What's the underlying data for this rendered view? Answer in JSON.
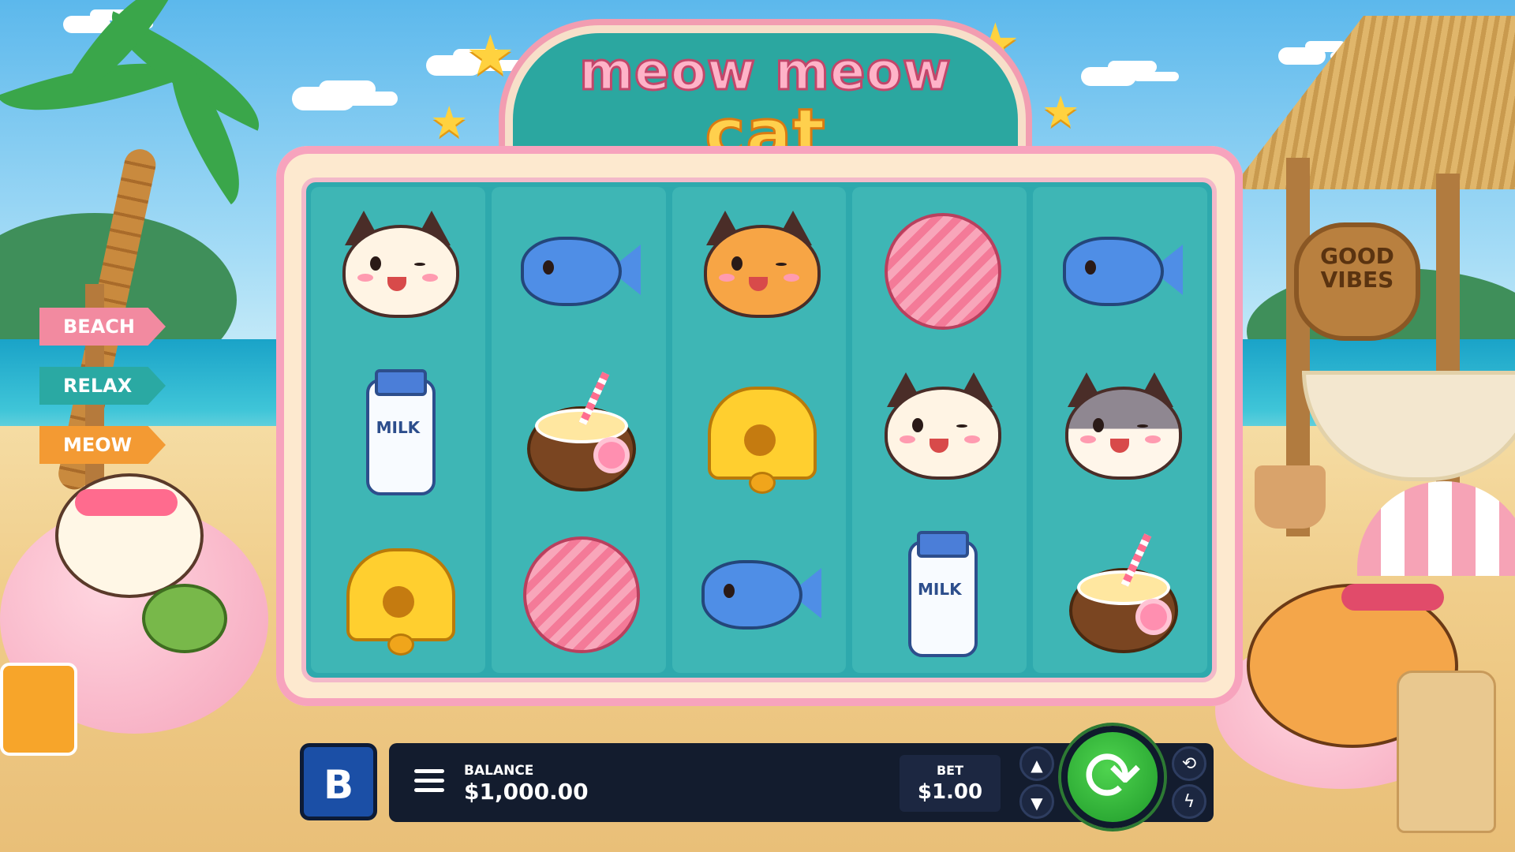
{
  "game": {
    "title_line1": "meow meow",
    "title_line2": "cat"
  },
  "scenery": {
    "signs": [
      "BEACH",
      "RELAX",
      "MEOW"
    ],
    "hut_sign": [
      "GOOD",
      "VIBES"
    ]
  },
  "reels": [
    [
      "cat-white",
      "fish",
      "milk",
      "coconut-drink",
      "bell"
    ],
    [
      "fish",
      "coconut-drink",
      "yarn"
    ],
    [
      "cat-orange",
      "bell",
      "fish"
    ],
    [
      "yarn",
      "cat-white",
      "milk"
    ],
    [
      "fish",
      "cat-gray",
      "coconut-drink"
    ]
  ],
  "symbols": {
    "milk_label": "MILK"
  },
  "controls": {
    "logo_letter": "B",
    "balance_label": "BALANCE",
    "balance_value": "$1,000.00",
    "bet_label": "BET",
    "bet_value": "$1.00",
    "bet_up_icon": "▲",
    "bet_down_icon": "▼",
    "spin_icon": "⟳",
    "autoplay_icon": "⟲",
    "turbo_icon": "ϟ"
  }
}
